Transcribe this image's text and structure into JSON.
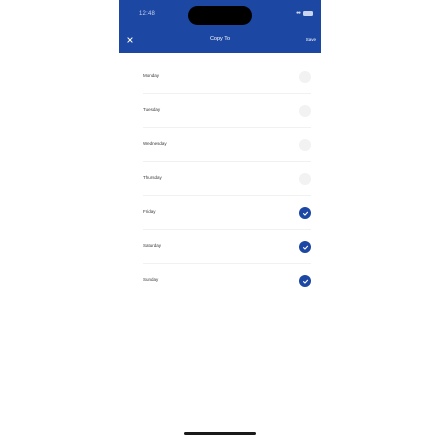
{
  "status_bar": {
    "time": "12:48"
  },
  "header": {
    "title": "Copy To",
    "save_label": "Save",
    "close_icon": "close-icon"
  },
  "colors": {
    "accent": "#1c47a3",
    "unchecked": "#f2f2f2"
  },
  "days": [
    {
      "label": "Monday",
      "selected": false
    },
    {
      "label": "Tuesday",
      "selected": false
    },
    {
      "label": "Wednesday",
      "selected": false
    },
    {
      "label": "Thursday",
      "selected": false
    },
    {
      "label": "Friday",
      "selected": true
    },
    {
      "label": "Saturday",
      "selected": true
    },
    {
      "label": "Sunday",
      "selected": true
    }
  ]
}
